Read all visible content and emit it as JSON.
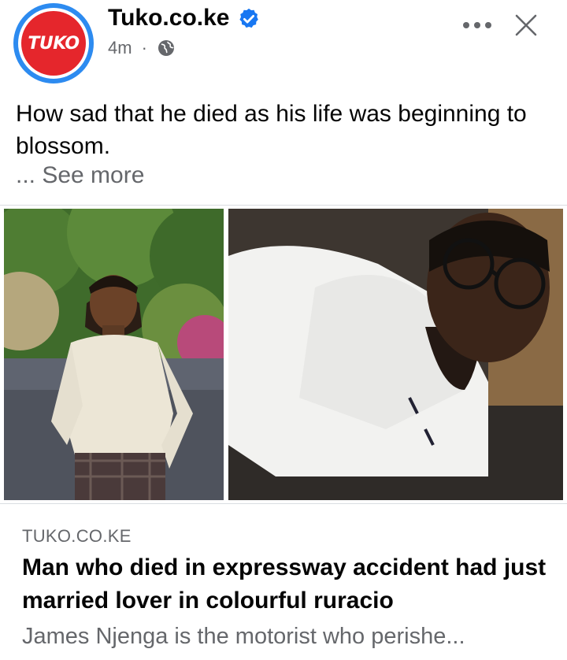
{
  "post": {
    "page_name": "Tuko.co.ke",
    "avatar_text": "TUKO",
    "timestamp": "4m",
    "separator": "·",
    "privacy_icon": "globe-icon",
    "verified_icon": "verified-badge-icon",
    "more_icon": "more-options-icon",
    "close_icon": "close-icon",
    "text": "How sad that he died as his life was beginning to blossom.",
    "see_more": "... See more"
  },
  "link_preview": {
    "domain": "TUKO.CO.KE",
    "headline": "Man who died in expressway accident had just married lover in colourful ruracio",
    "description": "James Njenga is the motorist who perishe..."
  },
  "colors": {
    "brand_red": "#e5262c",
    "brand_blue": "#2d8bf0",
    "verified_blue": "#1877f2",
    "secondary_text": "#65676b"
  }
}
